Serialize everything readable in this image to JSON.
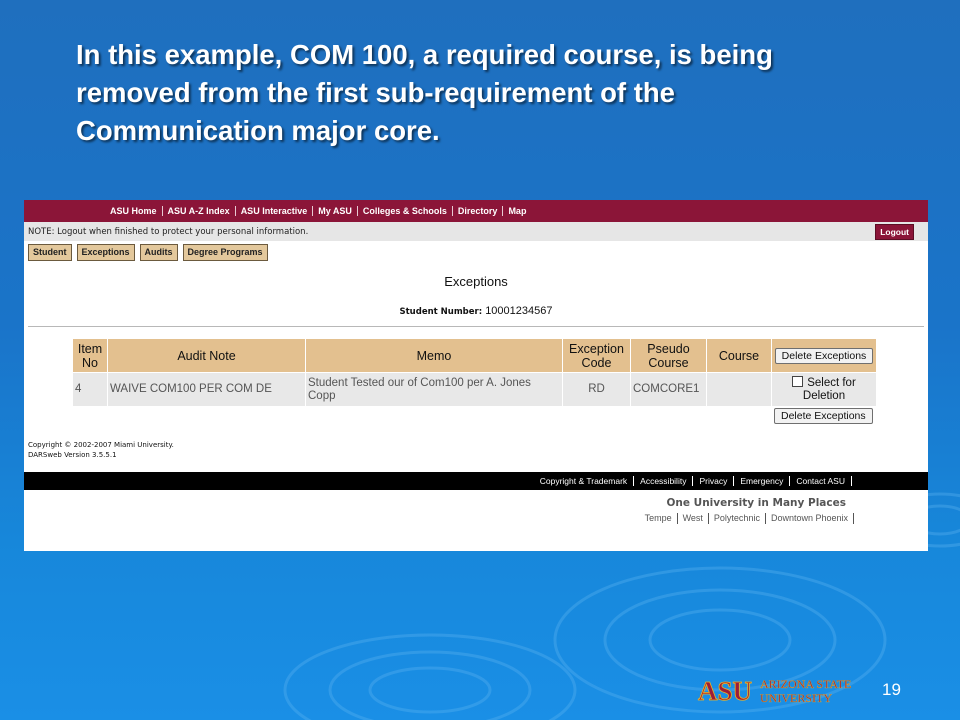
{
  "slide": {
    "title_lines": [
      "In this example, COM 100, a required course, is being",
      "removed from the first sub-requirement of the",
      "Communication major core."
    ],
    "page_number": "19",
    "logo": {
      "mark": "ASU",
      "name_line1": "ARIZONA STATE",
      "name_line2": "UNIVERSITY"
    }
  },
  "nav": {
    "items": [
      "ASU Home",
      "ASU A-Z Index",
      "ASU Interactive",
      "My ASU",
      "Colleges & Schools",
      "Directory",
      "Map"
    ]
  },
  "notice": {
    "text": "NOTE: Logout when finished to protect your personal information.",
    "logout_label": "Logout"
  },
  "tabs": [
    "Student",
    "Exceptions",
    "Audits",
    "Degree Programs"
  ],
  "page": {
    "heading": "Exceptions",
    "student_number_label": "Student Number:",
    "student_number": "10001234567"
  },
  "table": {
    "headers": {
      "item_no": [
        "Item",
        "No"
      ],
      "audit_note": "Audit Note",
      "memo": "Memo",
      "exception_code": [
        "Exception",
        "Code"
      ],
      "pseudo_course": [
        "Pseudo",
        "Course"
      ],
      "course": "Course"
    },
    "delete_button_label": "Delete Exceptions",
    "rows": [
      {
        "item_no": "4",
        "audit_note": "WAIVE COM100 PER COM DE",
        "memo": "Student Tested our of Com100 per A. Jones Copp",
        "exception_code": "RD",
        "pseudo_course": "COMCORE1",
        "course": "",
        "select_label": "Select for Deletion"
      }
    ]
  },
  "copyright": {
    "line1": "Copyright © 2002-2007 Miami University.",
    "line2": "DARSweb Version 3.5.5.1"
  },
  "footer": {
    "links": [
      "Copyright & Trademark",
      "Accessibility",
      "Privacy",
      "Emergency",
      "Contact ASU"
    ],
    "tagline": "One University in Many Places",
    "campuses": [
      "Tempe",
      "West",
      "Polytechnic",
      "Downtown Phoenix"
    ]
  },
  "colors": {
    "asu_maroon": "#8b1538",
    "header_tan": "#e3c08f",
    "slide_blue": "#1a74c9"
  }
}
